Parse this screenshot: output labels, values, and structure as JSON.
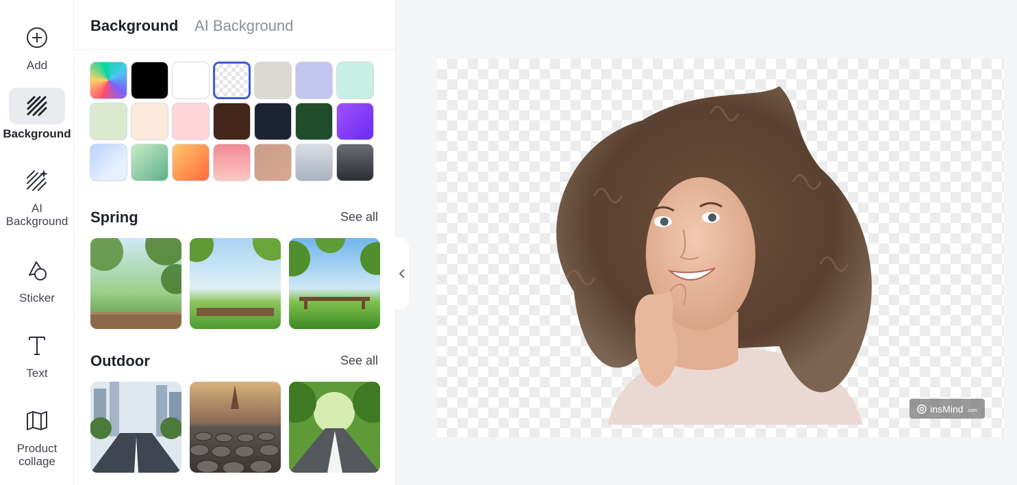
{
  "rail": {
    "items": [
      {
        "label": "Add",
        "icon": "plus-circle-icon"
      },
      {
        "label": "Background",
        "icon": "hatch-icon",
        "active": true
      },
      {
        "label": "AI Background",
        "icon": "hatch-sparkle-icon"
      },
      {
        "label": "Sticker",
        "icon": "sticker-icon"
      },
      {
        "label": "Text",
        "icon": "text-icon"
      },
      {
        "label": "Product collage",
        "icon": "map-icon"
      }
    ]
  },
  "panel": {
    "tabs": [
      {
        "label": "Background",
        "active": true
      },
      {
        "label": "AI Background",
        "active": false
      }
    ],
    "swatches": [
      {
        "name": "rainbow",
        "css": "conic-gradient(from 200deg, #ff4d6d, #ffd166, #06d6a0, #4cc9f0, #7b61ff, #ff4d6d)"
      },
      {
        "name": "black",
        "css": "#000000"
      },
      {
        "name": "white",
        "css": "#ffffff"
      },
      {
        "name": "transparent",
        "css": "transparent",
        "selected": true
      },
      {
        "name": "warm-gray",
        "css": "#dcd9d3"
      },
      {
        "name": "lavender",
        "css": "#c2c6ee"
      },
      {
        "name": "mint",
        "css": "#c8efe6"
      },
      {
        "name": "sage",
        "css": "#dbe9cf"
      },
      {
        "name": "peach",
        "css": "#fde9dc"
      },
      {
        "name": "pink",
        "css": "#fdd6d9"
      },
      {
        "name": "brown",
        "css": "#43251a"
      },
      {
        "name": "navy",
        "css": "#1c2434"
      },
      {
        "name": "forest",
        "css": "#1f4d2b"
      },
      {
        "name": "purple",
        "css": "linear-gradient(135deg,#a052ff,#6a2bf5)"
      },
      {
        "name": "sky-gradient",
        "css": "linear-gradient(135deg,#b8d4ff,#e7f0ff 70%)"
      },
      {
        "name": "green-gradient",
        "css": "linear-gradient(135deg,#c9ecc7,#5db089)"
      },
      {
        "name": "orange-gradient",
        "css": "linear-gradient(135deg,#ffc86b,#ff6a3d)"
      },
      {
        "name": "rose-gradient",
        "css": "linear-gradient(180deg,#f28a96,#fcc8c2)"
      },
      {
        "name": "tan-gradient",
        "css": "linear-gradient(135deg,#c99d8a,#d9a88e)"
      },
      {
        "name": "silver-gradient",
        "css": "linear-gradient(180deg,#d9dde5,#aab2bf)"
      },
      {
        "name": "charcoal-gradient",
        "css": "linear-gradient(180deg,#6a6e74,#2b2e33)"
      }
    ],
    "sections": [
      {
        "title": "Spring",
        "see_all": "See all"
      },
      {
        "title": "Outdoor",
        "see_all": "See all"
      }
    ]
  },
  "canvas": {
    "watermark": {
      "brand": "insMind",
      "suffix": ".com"
    }
  }
}
